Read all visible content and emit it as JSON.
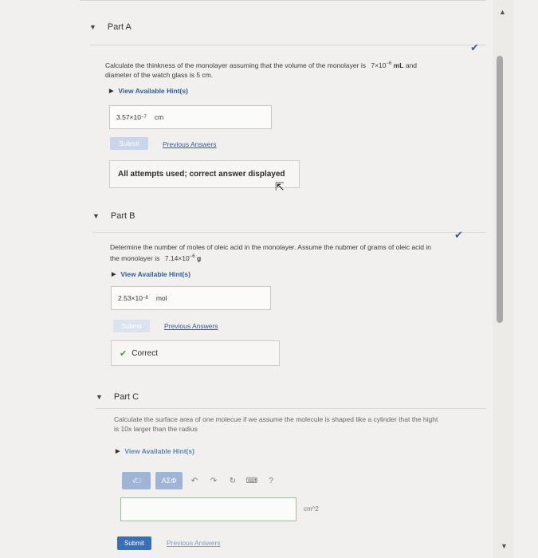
{
  "partA": {
    "title": "Part A",
    "prompt_line1_pre": "Calculate the thinkness of the monolayer assuming that the volume of the monolayer is",
    "prompt_vol_base": "7×10",
    "prompt_vol_exp": "−6",
    "prompt_vol_unit": "mL",
    "prompt_line1_post": "and",
    "prompt_line2": "diameter of the watch glass is 5 cm.",
    "hint": "View Available Hint(s)",
    "answer_base": "3.57×10",
    "answer_exp": "−7",
    "answer_unit": "cm",
    "submit": "Submit",
    "previous": "Previous Answers",
    "feedback": "All attempts used; correct answer displayed"
  },
  "partB": {
    "title": "Part B",
    "prompt_line1": "Determine the number of moles of oleic acid in the monolayer. Assume the nubmer of grams of oleic acid in",
    "prompt_line2_pre": "the monolayer is",
    "prompt_mass_base": "7.14×10",
    "prompt_mass_exp": "−6",
    "prompt_mass_unit": "g",
    "hint": "View Available Hint(s)",
    "answer_base": "2.53×10",
    "answer_exp": "−8",
    "answer_unit": "mol",
    "submit": "Submit",
    "previous": "Previous Answers",
    "feedback": "Correct"
  },
  "partC": {
    "title": "Part C",
    "prompt_line1": "Calculate the surface area of one molecue if we assume the molecule is shaped like a cylinder that the hight",
    "prompt_line2": "is 10x larger than the radius",
    "hint": "View Available Hint(s)",
    "toolbar": {
      "template": "√□",
      "symbols": "ΑΣΦ",
      "undo_icon": "undo-icon",
      "redo_icon": "redo-icon",
      "reset_icon": "reset-icon",
      "keyboard_icon": "keyboard-icon",
      "help": "?"
    },
    "answer_value": "",
    "unit": "cm^2",
    "submit": "Submit",
    "previous": "Previous Answers"
  },
  "colors": {
    "accent_blue": "#2f5d9a",
    "submit_blue": "#3a6fb5",
    "submit_disabled": "#c9d6ea",
    "check": "#3a5d9a",
    "correct_green": "#4a9a3a"
  }
}
